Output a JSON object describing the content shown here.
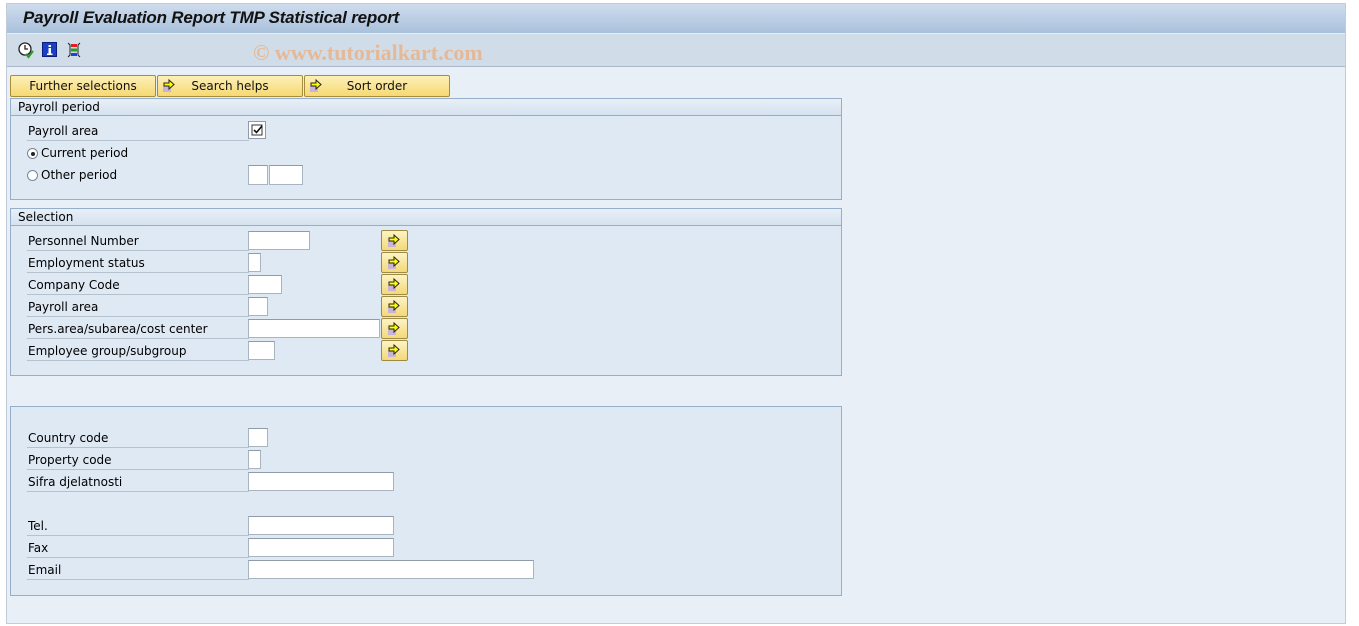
{
  "window": {
    "title": "Payroll Evaluation Report TMP Statistical report",
    "watermark": "© www.tutorialkart.com"
  },
  "toolbar": {
    "icons": [
      "execute-clock-icon",
      "info-icon",
      "selection-options-icon"
    ]
  },
  "top_buttons": [
    {
      "label": "Further selections",
      "icon": null
    },
    {
      "label": "Search helps",
      "icon": "arrow-right-icon"
    },
    {
      "label": "Sort order",
      "icon": "arrow-right-icon"
    }
  ],
  "payroll_period": {
    "title": "Payroll period",
    "payroll_area_label": "Payroll area",
    "payroll_area_checked": true,
    "current_period_label": "Current period",
    "current_period_selected": true,
    "other_period_label": "Other period",
    "other_period_selected": false,
    "other_period_value1": "",
    "other_period_value2": ""
  },
  "selection": {
    "title": "Selection",
    "fields": [
      {
        "label": "Personnel Number",
        "value": ""
      },
      {
        "label": "Employment status",
        "value": ""
      },
      {
        "label": "Company Code",
        "value": ""
      },
      {
        "label": "Payroll area",
        "value": ""
      },
      {
        "label": "Pers.area/subarea/cost center",
        "value": ""
      },
      {
        "label": "Employee group/subgroup",
        "value": ""
      }
    ]
  },
  "additional": {
    "fields": [
      {
        "label": "Country code",
        "value": ""
      },
      {
        "label": "Property code",
        "value": ""
      },
      {
        "label": "Sifra djelatnosti",
        "value": ""
      },
      {
        "label": "Tel.",
        "value": ""
      },
      {
        "label": "Fax",
        "value": ""
      },
      {
        "label": "Email",
        "value": ""
      }
    ]
  },
  "colors": {
    "button_yellow": "#f6d972",
    "group_bg": "#dfe9f4",
    "title_blue": "#a9c1dc"
  }
}
